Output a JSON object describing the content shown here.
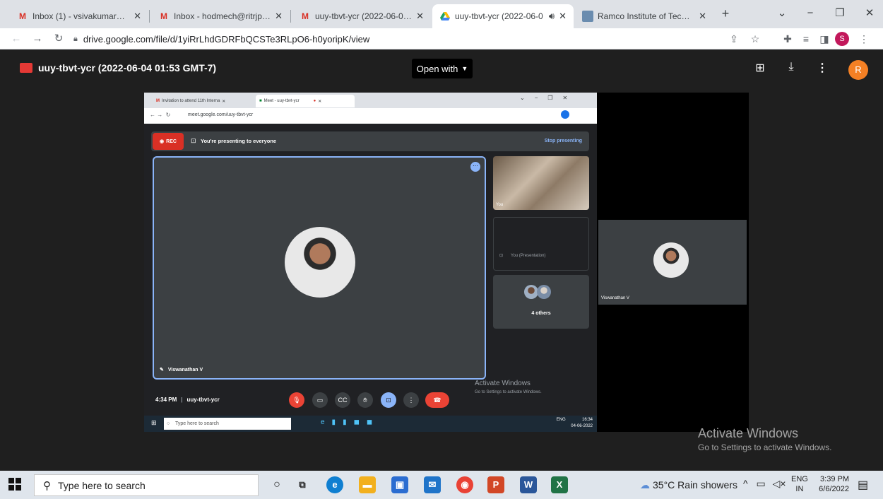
{
  "browser": {
    "tabs": [
      {
        "label": "Inbox (1) - vsivakumar@ritrjp",
        "icon": "gmail-icon",
        "active": false
      },
      {
        "label": "Inbox - hodmech@ritrjpm.ac",
        "icon": "gmail-icon",
        "active": false
      },
      {
        "label": "uuy-tbvt-ycr (2022-06-04 01",
        "icon": "gmail-icon",
        "active": false
      },
      {
        "label": "uuy-tbvt-ycr (2022-06-0",
        "icon": "drive-icon",
        "active": true
      },
      {
        "label": "Ramco Institute of Technolo",
        "icon": "site-icon",
        "active": false
      }
    ],
    "url": "drive.google.com/file/d/1yiRrLhdGDRFbQCSTe3RLpO6-h0yoripK/view",
    "profile_initial": "S"
  },
  "viewer": {
    "file_title": "uuy-tbvt-ycr (2022-06-04 01:53 GMT-7)",
    "open_with": "Open with",
    "avatar_initial": "R"
  },
  "meet": {
    "inner_tabs": [
      "Invitation to attend 11th Interna",
      "Meet - uuy-tbvt-ycr"
    ],
    "inner_url": "meet.google.com/uuy-tbvt-ycr",
    "rec_label": "REC",
    "presenting_text": "You're presenting to everyone",
    "stop_presenting": "Stop presenting",
    "main_participant": "Viswanathan V",
    "self_label": "You",
    "presentation_label": "You (Presentation)",
    "others_label": "4 others",
    "time_meeting": "4:34 PM",
    "meeting_code": "uuy-tbvt-ycr",
    "inner_search_placeholder": "Type here to search",
    "inner_tray_lang": "ENG",
    "inner_tray_time": "16:34",
    "inner_tray_date": "04-06-2022",
    "inner_activate": "Activate Windows",
    "inner_activate_sub": "Go to Settings to activate Windows.",
    "side_participant": "Viswanathan V"
  },
  "activate": {
    "title": "Activate Windows",
    "subtitle": "Go to Settings to activate Windows."
  },
  "taskbar": {
    "search_placeholder": "Type here to search",
    "weather": "35°C  Rain showers",
    "lang_top": "ENG",
    "lang_bottom": "IN",
    "time": "3:39 PM",
    "date": "6/6/2022"
  }
}
